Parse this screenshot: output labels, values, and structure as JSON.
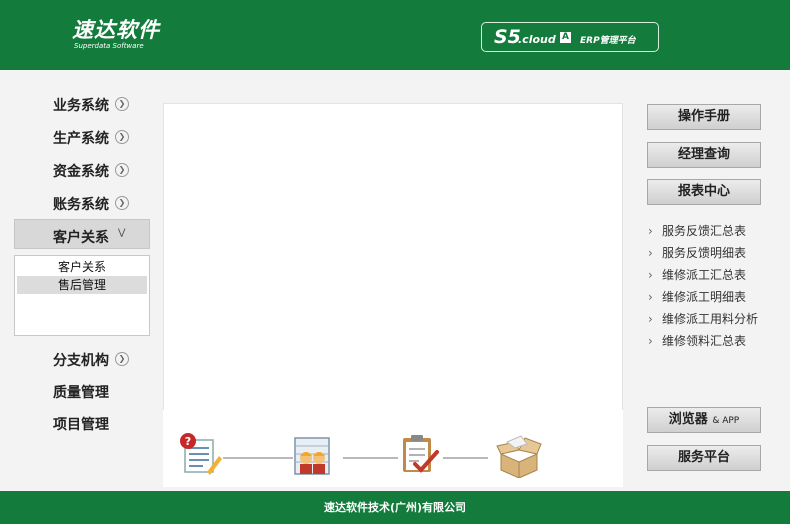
{
  "header": {
    "logo_cn": "速达软件",
    "logo_en": "Superdata Software",
    "badge": {
      "s5": "S5",
      "cloud": ".cloud",
      "edition": "A",
      "subtitle": "ERP管理平台"
    }
  },
  "leftnav": {
    "items": [
      {
        "label": "业务系统"
      },
      {
        "label": "生产系统"
      },
      {
        "label": "资金系统"
      },
      {
        "label": "账务系统"
      }
    ],
    "active": {
      "label": "客户关系"
    },
    "submenu": [
      {
        "label": "客户关系",
        "selected": false
      },
      {
        "label": "售后管理",
        "selected": true
      }
    ],
    "after_items": [
      {
        "label": "分支机构",
        "chevron": true
      },
      {
        "label": "质量管理",
        "chevron": false
      },
      {
        "label": "项目管理",
        "chevron": false
      }
    ]
  },
  "right": {
    "buttons": [
      {
        "label": "操作手册"
      },
      {
        "label": "经理查询"
      },
      {
        "label": "报表中心"
      }
    ],
    "reports": [
      "服务反馈汇总表",
      "服务反馈明细表",
      "维修派工汇总表",
      "维修派工明细表",
      "维修派工用料分析",
      "维修领料汇总表"
    ],
    "bottom_buttons": [
      {
        "label": "浏览器",
        "suffix": "& APP"
      },
      {
        "label": "服务平台",
        "suffix": ""
      }
    ]
  },
  "flow_icons": [
    "service-request-icon",
    "dispatch-workers-icon",
    "checklist-approve-icon",
    "delivery-box-icon"
  ],
  "footer": {
    "text": "速达软件技术(广州)有限公司"
  },
  "colors": {
    "brand_green": "#137b3c",
    "panel_white": "#ffffff",
    "background": "#f3f3f3"
  }
}
